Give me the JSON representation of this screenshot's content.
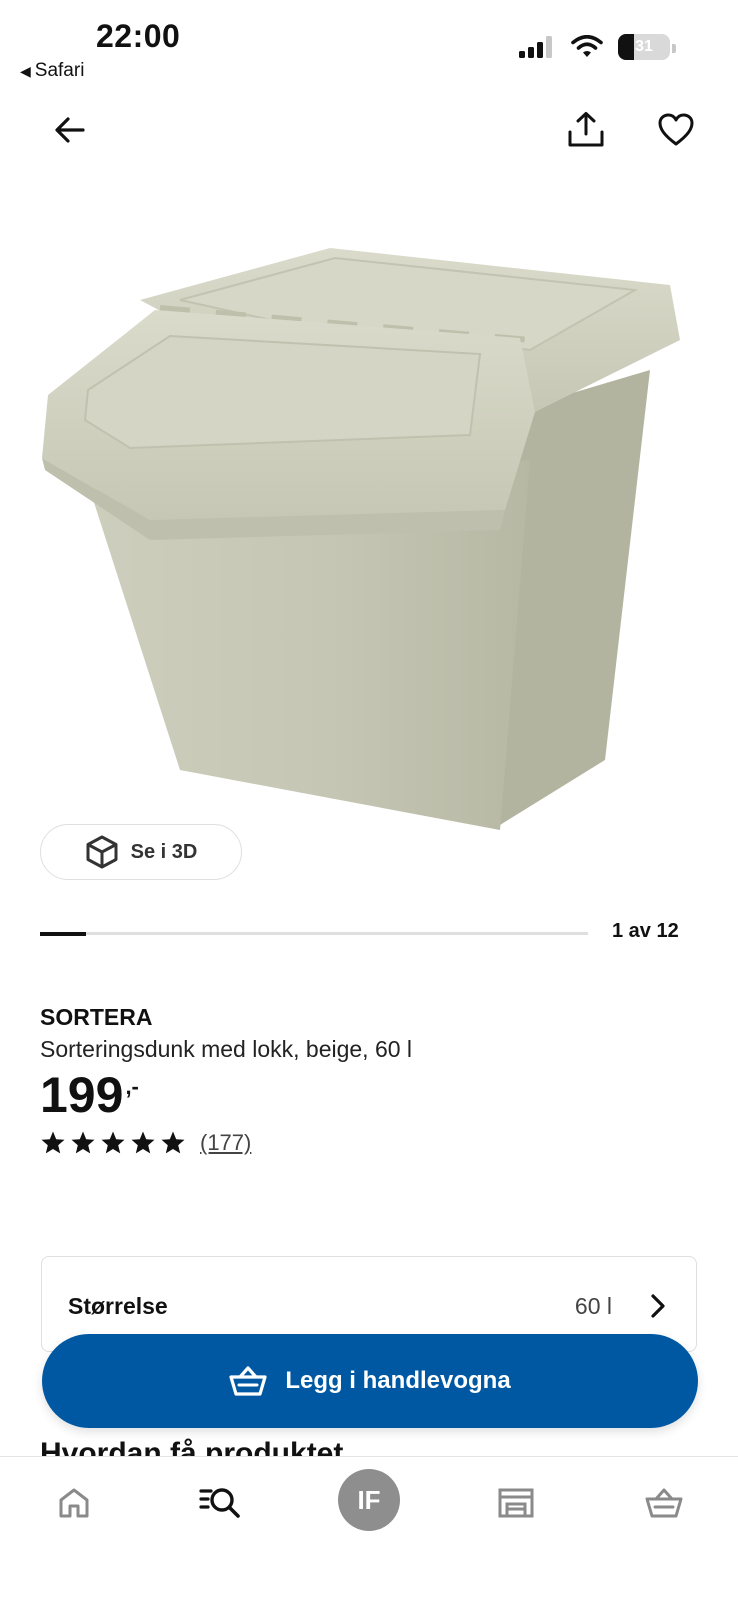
{
  "status_bar": {
    "time": "22:00",
    "back_app": "Safari",
    "battery": "31"
  },
  "gallery": {
    "view_3d_label": "Se i 3D",
    "counter": "1 av 12",
    "progress_fraction": 0.0833
  },
  "product": {
    "name": "SORTERA",
    "description": "Sorteringsdunk med lokk, beige, 60 l",
    "price": "199",
    "price_suffix": ",-",
    "rating_stars": 5,
    "review_count": "(177)"
  },
  "size_selector": {
    "label": "Størrelse",
    "value": "60 l"
  },
  "cart_button": {
    "label": "Legg i handlevogna"
  },
  "delivery": {
    "heading": "Hvordan få produktet"
  },
  "bottom_nav": {
    "profile_initials": "IF"
  },
  "icons": {
    "back": "arrow-left-icon",
    "share": "share-icon",
    "favorite": "heart-icon",
    "view_3d": "cube-icon",
    "chevron": "chevron-right-icon",
    "cart": "basket-icon",
    "home": "home-icon",
    "search": "search-icon",
    "store": "store-icon"
  },
  "colors": {
    "primary": "#0058a3",
    "product": "#c9cab7"
  }
}
